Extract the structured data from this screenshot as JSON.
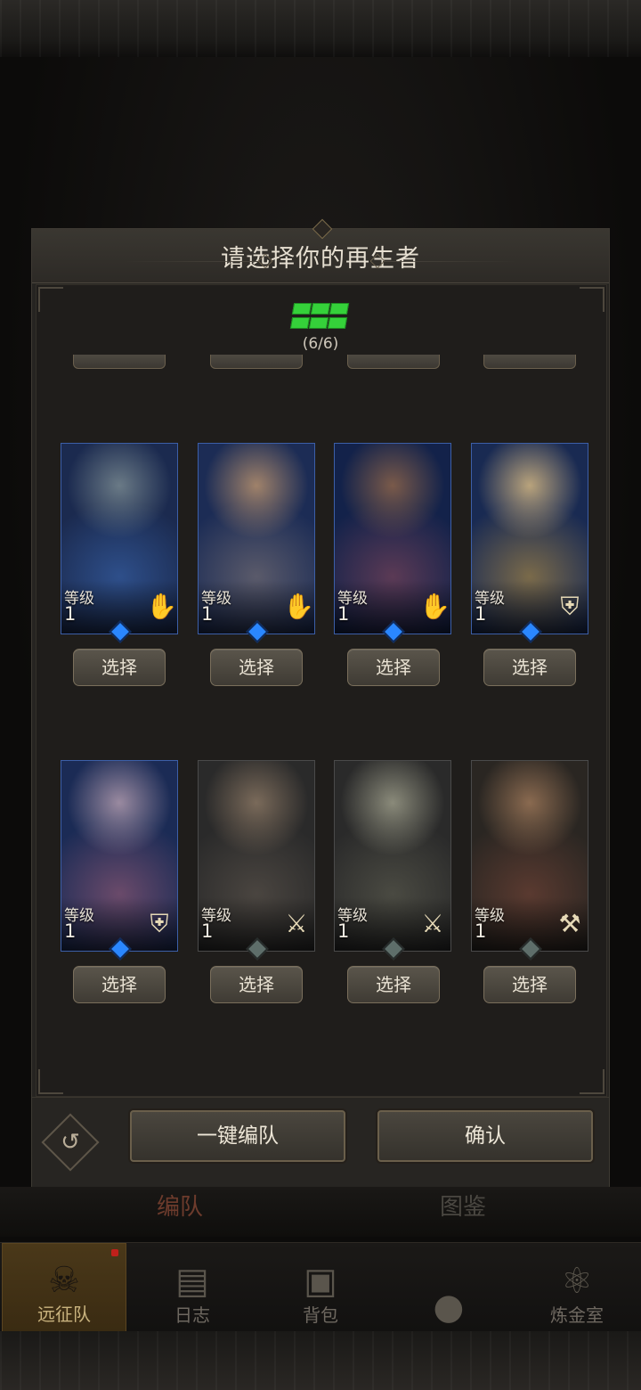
{
  "dialog": {
    "title": "请选择你的再生者",
    "formation_count": "(6/6)",
    "formation_icon": "formation-grid-icon",
    "select_label": "选择",
    "level_label": "等级",
    "buttons": {
      "auto_team": "一键编队",
      "confirm": "确认",
      "reset_icon": "undo-icon"
    }
  },
  "cards": [
    {
      "level": "1",
      "class_icon": "hand-icon",
      "frame": "blue",
      "portrait_colors": [
        "#1b2a4f",
        "#2e4f8a",
        "#6a7a86"
      ]
    },
    {
      "level": "1",
      "class_icon": "hand-icon",
      "frame": "blue",
      "portrait_colors": [
        "#1c2c55",
        "#5a5a6a",
        "#a0826a"
      ]
    },
    {
      "level": "1",
      "class_icon": "hand-icon",
      "frame": "blue",
      "portrait_colors": [
        "#13224a",
        "#5b3a55",
        "#7a5a4a"
      ]
    },
    {
      "level": "1",
      "class_icon": "shield-icon",
      "frame": "blue",
      "portrait_colors": [
        "#192a52",
        "#7a6a4a",
        "#b9a37c"
      ]
    },
    {
      "level": "1",
      "class_icon": "shield-icon",
      "frame": "blue",
      "portrait_colors": [
        "#1b2b55",
        "#6a4a6a",
        "#9a8aa0"
      ]
    },
    {
      "level": "1",
      "class_icon": "sword-icon",
      "frame": "grey",
      "portrait_colors": [
        "#2a2a2a",
        "#4a4540",
        "#7a6a5a"
      ]
    },
    {
      "level": "1",
      "class_icon": "sword-icon",
      "frame": "grey",
      "portrait_colors": [
        "#2a2a2a",
        "#4a4a42",
        "#8a8a7a"
      ]
    },
    {
      "level": "1",
      "class_icon": "staff-icon",
      "frame": "grey",
      "portrait_colors": [
        "#2a2622",
        "#5a3a30",
        "#8a6a50"
      ]
    }
  ],
  "under_tabs": [
    "编队",
    "图鉴"
  ],
  "bottom_nav": [
    {
      "label": "远征队",
      "icon": "viking-helmet-icon",
      "active": true
    },
    {
      "label": "日志",
      "icon": "scroll-icon",
      "active": false
    },
    {
      "label": "背包",
      "icon": "backpack-icon",
      "active": false
    },
    {
      "label": "",
      "icon": "locked-icon",
      "active": false
    },
    {
      "label": "炼金室",
      "icon": "alchemy-icon",
      "active": false
    }
  ]
}
